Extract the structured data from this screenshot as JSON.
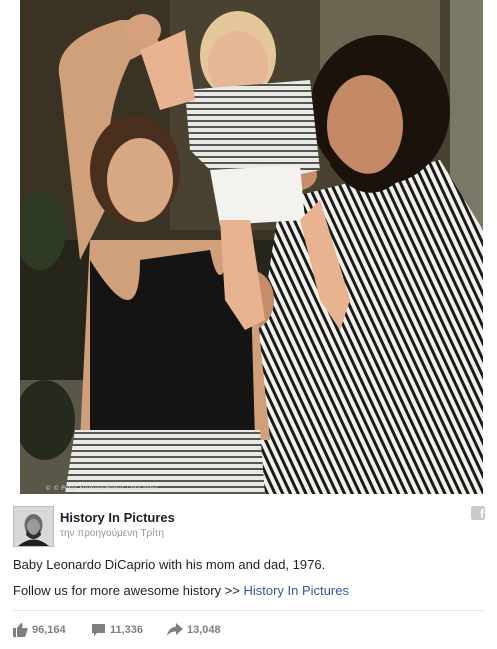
{
  "photo": {
    "alt_subject": "family-photo",
    "credit": "© © Peter Fleming/Rebus Ltd/Corbis"
  },
  "post": {
    "page_name": "History In Pictures",
    "time": "την προηγούμενη Τρίτη",
    "caption": "Baby Leonardo DiCaprio with his mom and dad, 1976.",
    "follow_prefix": "Follow us for more awesome history >> ",
    "follow_link": "History In Pictures",
    "platform_icon": "f"
  },
  "stats": {
    "likes": "96,164",
    "comments": "11,336",
    "shares": "13,048"
  },
  "icons": {
    "like": "thumbs-up-icon",
    "comment": "comment-icon",
    "share": "share-arrow-icon",
    "platform": "facebook-icon"
  },
  "colors": {
    "link": "#365899",
    "stat_gray": "#7f7f7f",
    "text": "#1d2129",
    "meta": "#90949c"
  }
}
